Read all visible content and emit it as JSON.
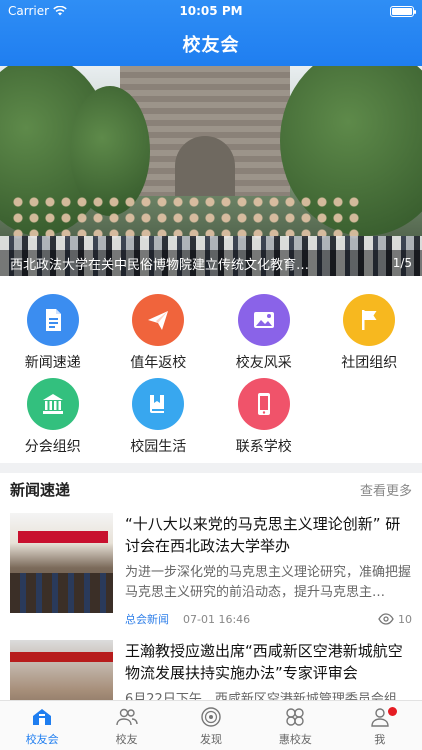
{
  "status": {
    "carrier": "Carrier",
    "time": "10:05 PM"
  },
  "nav": {
    "title": "校友会"
  },
  "banner": {
    "caption": "西北政法大学在关中民俗博物院建立传统文化教育…",
    "pager": "1/5"
  },
  "grid": [
    {
      "label": "新闻速递",
      "icon": "document-icon",
      "color": "#3b8df0"
    },
    {
      "label": "值年返校",
      "icon": "paper-plane-icon",
      "color": "#f0643c"
    },
    {
      "label": "校友风采",
      "icon": "image-icon",
      "color": "#8a63e8"
    },
    {
      "label": "社团组织",
      "icon": "flag-icon",
      "color": "#f7b81f"
    },
    {
      "label": "分会组织",
      "icon": "building-icon",
      "color": "#33c07e"
    },
    {
      "label": "校园生活",
      "icon": "book-icon",
      "color": "#38a7ef"
    },
    {
      "label": "联系学校",
      "icon": "phone-icon",
      "color": "#f0536a"
    }
  ],
  "news": {
    "title": "新闻速递",
    "more": "查看更多",
    "items": [
      {
        "headline": "“十八大以来党的马克思主义理论创新” 研讨会在西北政法大学举办",
        "desc": "为进一步深化党的马克思主义理论研究，准确把握马克思主义研究的前沿动态，提升马克思主…",
        "source": "总会新闻",
        "date": "07-01 16:46",
        "views": "10"
      },
      {
        "headline": "王瀚教授应邀出席“西咸新区空港新城航空物流发展扶持实施办法”专家评审会",
        "desc": "6月22日下午，西咸新区空港新城管理委员会组"
      }
    ]
  },
  "tabs": [
    {
      "label": "校友会",
      "icon": "home-icon",
      "active": true
    },
    {
      "label": "校友",
      "icon": "people-icon"
    },
    {
      "label": "发现",
      "icon": "compass-icon"
    },
    {
      "label": "惠校友",
      "icon": "clover-icon"
    },
    {
      "label": "我",
      "icon": "user-icon",
      "badge": true
    }
  ]
}
